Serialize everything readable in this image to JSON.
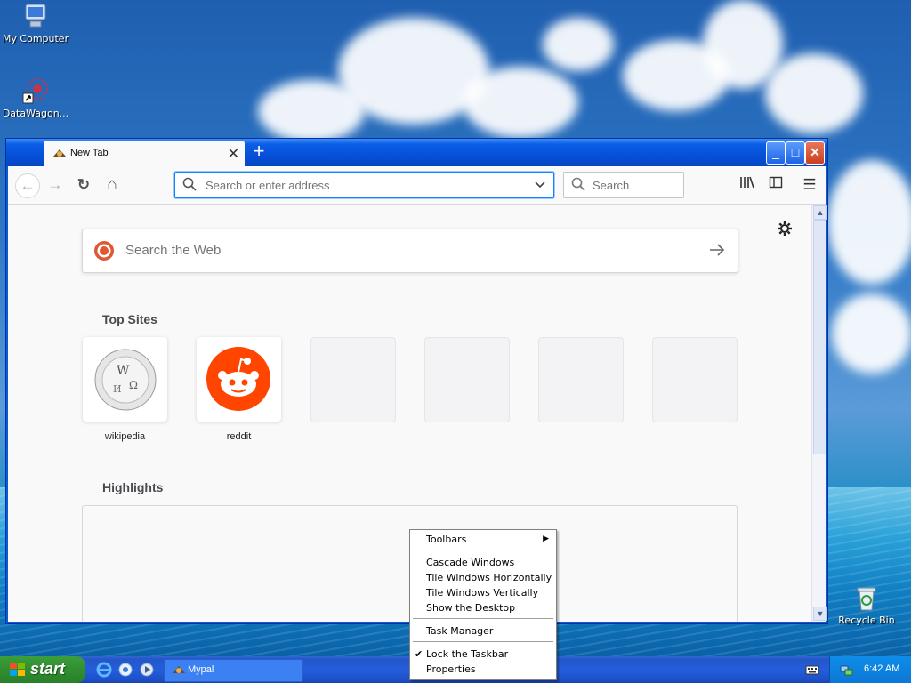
{
  "desktop": {
    "icons": [
      {
        "label": "My Computer",
        "icon": "my-computer-icon"
      },
      {
        "label": "DataWagon...",
        "icon": "datawagon-icon"
      },
      {
        "label": "Recycle Bin",
        "icon": "recycle-bin-icon"
      }
    ]
  },
  "browser": {
    "tab": {
      "title": "New Tab",
      "close": "✕"
    },
    "new_tab": "+",
    "window_buttons": {
      "minimize": "_",
      "maximize": "□",
      "close": "✕"
    },
    "toolbar": {
      "back": "←",
      "forward": "→",
      "reload": "↻",
      "home": "⌂",
      "url_placeholder": "Search or enter address",
      "search_placeholder": "Search",
      "library": "|||\\",
      "sidebar": "◫",
      "menu": "☰"
    },
    "newtab_page": {
      "web_search_placeholder": "Search the Web",
      "top_sites_title": "Top Sites",
      "top_sites": [
        {
          "label": "wikipedia"
        },
        {
          "label": "reddit"
        }
      ],
      "highlights_title": "Highlights"
    }
  },
  "context_menu": {
    "items": [
      {
        "label": "Toolbars",
        "submenu": true
      },
      {
        "label": "Cascade Windows"
      },
      {
        "label": "Tile Windows Horizontally"
      },
      {
        "label": "Tile Windows Vertically"
      },
      {
        "label": "Show the Desktop"
      },
      {
        "label": "Task Manager"
      },
      {
        "label": "Lock the Taskbar",
        "checked": true
      },
      {
        "label": "Properties"
      }
    ]
  },
  "taskbar": {
    "start_label": "start",
    "task_label": "Mypal",
    "clock": "6:42 AM"
  },
  "colors": {
    "titlebar": "#0650d9",
    "accent": "#0a84ff",
    "taskbar": "#245ddb",
    "start": "#2f8f2f",
    "reddit": "#ff4500"
  }
}
